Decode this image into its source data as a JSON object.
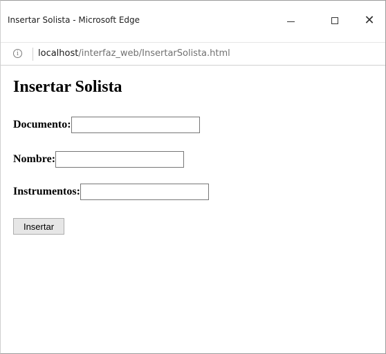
{
  "window": {
    "title": "Insertar Solista - Microsoft Edge",
    "close_glyph": "✕"
  },
  "address": {
    "info_glyph": "i",
    "host": "localhost",
    "path": "/interfaz_web/InsertarSolista.html"
  },
  "page": {
    "heading": "Insertar Solista",
    "fields": [
      {
        "label": "Documento:",
        "value": ""
      },
      {
        "label": "Nombre:",
        "value": ""
      },
      {
        "label": "Instrumentos:",
        "value": ""
      }
    ],
    "submit_label": "Insertar"
  }
}
